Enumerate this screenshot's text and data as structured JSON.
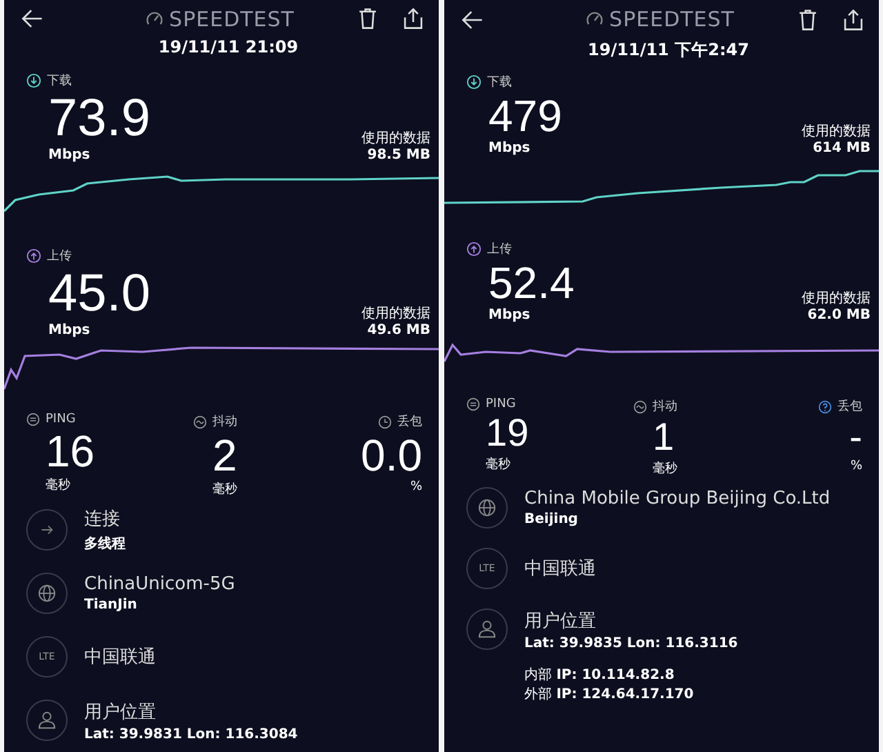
{
  "panels": [
    {
      "title": "SPEEDTEST",
      "timestamp": "19/11/11 21:09",
      "metrics": [
        {
          "kind": "download",
          "label": "下载",
          "value": "73.9",
          "unit": "Mbps",
          "data_label": "使用的数据",
          "data_value": "98.5 MB"
        },
        {
          "kind": "upload",
          "label": "上传",
          "value": "45.0",
          "unit": "Mbps",
          "data_label": "使用的数据",
          "data_value": "49.6 MB"
        }
      ],
      "stats": [
        {
          "kind": "ping",
          "label": "PING",
          "value": "16",
          "unit": "毫秒"
        },
        {
          "kind": "jitter",
          "label": "抖动",
          "value": "2",
          "unit": "毫秒"
        },
        {
          "kind": "loss",
          "label": "丢包",
          "value": "0.0",
          "unit": "%"
        }
      ],
      "info": [
        {
          "kind": "connection",
          "title": "连接",
          "subtitle": "多线程"
        },
        {
          "kind": "server",
          "title": "ChinaUnicom-5G",
          "subtitle": "TianJin"
        },
        {
          "kind": "carrier",
          "badge": "LTE",
          "title": "中国联通"
        },
        {
          "kind": "location",
          "title": "用户位置",
          "subtitle": "Lat: 39.9831 Lon: 116.3084"
        }
      ]
    },
    {
      "title": "SPEEDTEST",
      "timestamp": "19/11/11 下午2:47",
      "metrics": [
        {
          "kind": "download",
          "label": "下载",
          "value": "479",
          "unit": "Mbps",
          "data_label": "使用的数据",
          "data_value": "614 MB"
        },
        {
          "kind": "upload",
          "label": "上传",
          "value": "52.4",
          "unit": "Mbps",
          "data_label": "使用的数据",
          "data_value": "62.0 MB"
        }
      ],
      "stats": [
        {
          "kind": "ping",
          "label": "PING",
          "value": "19",
          "unit": "毫秒"
        },
        {
          "kind": "jitter",
          "label": "抖动",
          "value": "1",
          "unit": "毫秒"
        },
        {
          "kind": "help",
          "label": "丢包",
          "value": "-",
          "unit": "%"
        }
      ],
      "info": [
        {
          "kind": "server",
          "title": "China Mobile Group Beijing Co.Ltd",
          "subtitle": "Beijing"
        },
        {
          "kind": "carrier",
          "badge": "LTE",
          "title": "中国联通"
        },
        {
          "kind": "location",
          "title": "用户位置",
          "subtitle": "Lat: 39.9835 Lon: 116.3116"
        }
      ],
      "ip_lines": [
        "内部 **IP: 10.114.82.8**",
        "外部 **IP: 124.64.17.170**"
      ]
    }
  ]
}
